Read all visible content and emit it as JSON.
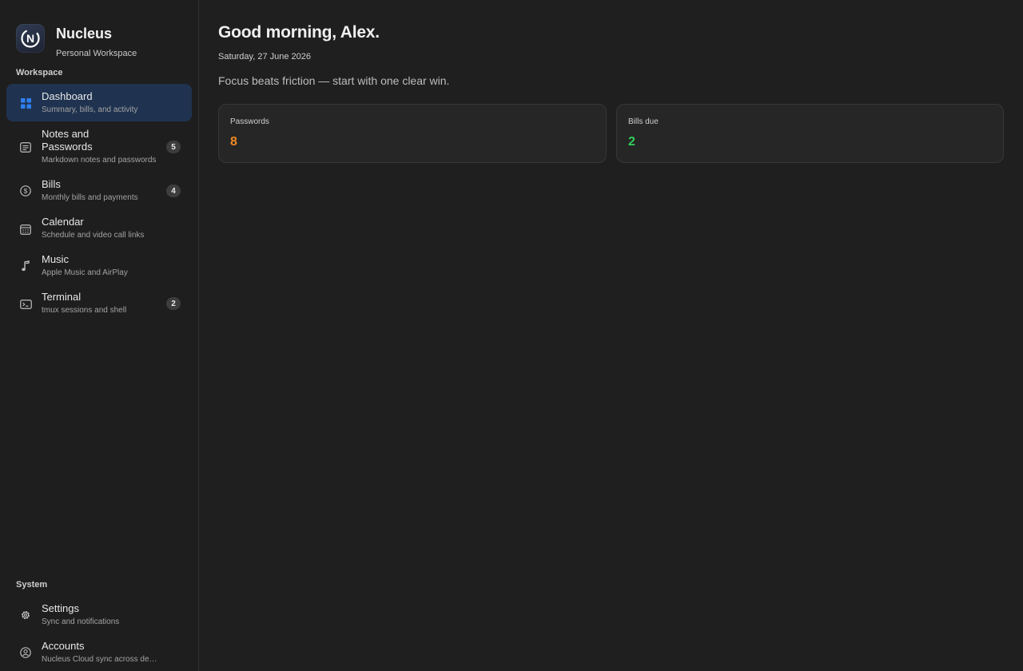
{
  "brand": {
    "title": "Nucleus",
    "subtitle": "Personal Workspace",
    "logo_letter": "N"
  },
  "sidebar": {
    "workspace_label": "Workspace",
    "system_label": "System",
    "items": [
      {
        "title": "Dashboard",
        "desc": "Summary, bills, and activity",
        "icon": "grid-icon",
        "active": true
      },
      {
        "title": "Notes and Passwords",
        "desc": "Markdown notes and passwords",
        "icon": "note-icon",
        "badge": "5"
      },
      {
        "title": "Bills",
        "desc": "Monthly bills and payments",
        "icon": "dollar-icon",
        "badge": "4"
      },
      {
        "title": "Calendar",
        "desc": "Schedule and video call links",
        "icon": "calendar-icon"
      },
      {
        "title": "Music",
        "desc": "Apple Music and AirPlay",
        "icon": "music-note-icon"
      },
      {
        "title": "Terminal",
        "desc": "tmux sessions and shell",
        "icon": "terminal-icon",
        "badge": "2"
      }
    ],
    "system_items": [
      {
        "title": "Settings",
        "desc": "Sync and notifications",
        "icon": "gear-icon"
      },
      {
        "title": "Accounts",
        "desc": "Nucleus Cloud sync across devices",
        "icon": "accounts-icon"
      }
    ]
  },
  "main": {
    "greeting": "Good morning, Alex.",
    "date": "Saturday, 27 June 2026",
    "tagline": "Focus beats friction — start with one clear win.",
    "cards": [
      {
        "label": "Passwords",
        "value": "8",
        "color": "#f08a24"
      },
      {
        "label": "Bills due",
        "value": "2",
        "color": "#2fcf5b"
      }
    ]
  },
  "colors": {
    "accent": "#2f7ff0",
    "active_bg": "#1f3350",
    "background": "#1f1f1f"
  }
}
